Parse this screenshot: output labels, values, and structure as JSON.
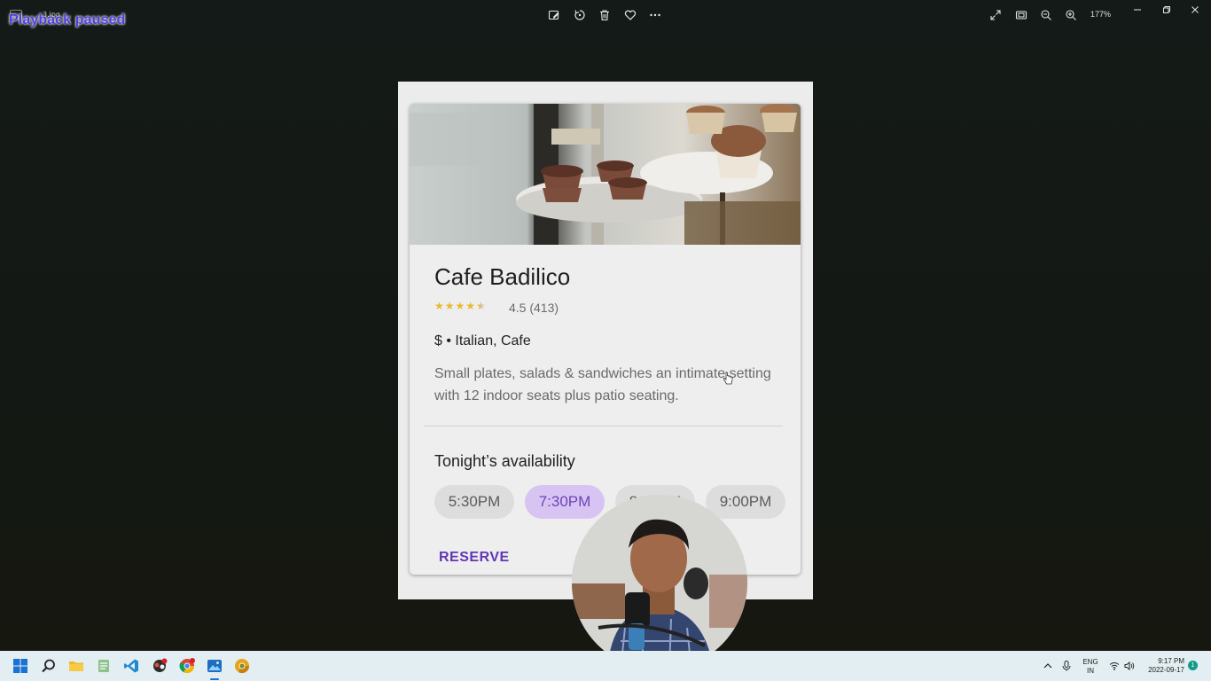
{
  "viewer": {
    "file_name": "3.jpg",
    "overlay_text": "Playback paused",
    "toolbar": [
      {
        "name": "edit-image-icon",
        "label": "Edit image"
      },
      {
        "name": "rotate-icon",
        "label": "Rotate"
      },
      {
        "name": "delete-icon",
        "label": "Delete"
      },
      {
        "name": "favorite-icon",
        "label": "Favorite"
      },
      {
        "name": "more-options-icon",
        "label": "More options"
      }
    ],
    "zoom_level": "177%"
  },
  "card": {
    "title": "Cafe Badilico",
    "rating": 4.5,
    "rating_text": "4.5 (413)",
    "category": "$ • Italian, Cafe",
    "description": "Small plates, salads & sandwiches an intimate setting with 12 indoor seats plus patio seating.",
    "availability_title": "Tonight’s availability",
    "times": [
      "5:30PM",
      "7:30PM",
      "8:00PM",
      "9:00PM"
    ],
    "selected_time": "7:30PM",
    "reserve_label": "RESERVE",
    "accent_color": "#6236b5",
    "chip_selected_color": "#d8c4f3",
    "star_color": "#e9b92d"
  },
  "taskbar": {
    "apps": [
      "start-icon",
      "search-icon",
      "file-explorer-icon",
      "notepad-icon",
      "vscode-icon",
      "app-icon",
      "chrome-icon",
      "photos-icon",
      "canary-icon"
    ],
    "language": "ENG",
    "region": "IN",
    "time": "9:17 PM",
    "date": "2022-09-17",
    "notification_count": "1"
  }
}
